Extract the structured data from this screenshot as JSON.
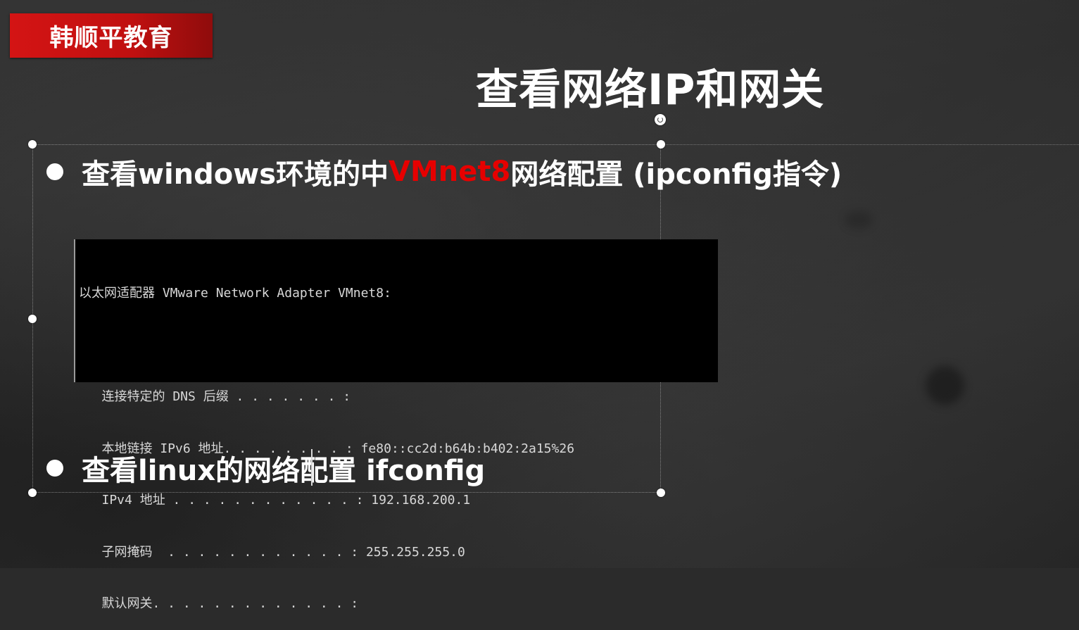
{
  "brand": {
    "label": "韩顺平教育",
    "color": "#d41414"
  },
  "slide": {
    "title": "查看网络IP和网关",
    "bullets": [
      {
        "prefix": "查看windows环境的中",
        "highlight": "VMnet8",
        "suffix": "网络配置 (ipconfig指令)",
        "highlight_color": "#e60000"
      },
      {
        "text": "查看linux的网络配置 ifconfig"
      }
    ]
  },
  "terminal": {
    "lines": [
      "以太网适配器 VMware Network Adapter VMnet8:",
      "",
      "   连接特定的 DNS 后缀 . . . . . . . :",
      "   本地链接 IPv6 地址. . . . . . . . : fe80::cc2d:b64b:b402:2a15%26",
      "   IPv4 地址 . . . . . . . . . . . . : 192.168.200.1",
      "   子网掩码  . . . . . . . . . . . . : 255.255.255.0",
      "   默认网关. . . . . . . . . . . . . :"
    ]
  }
}
